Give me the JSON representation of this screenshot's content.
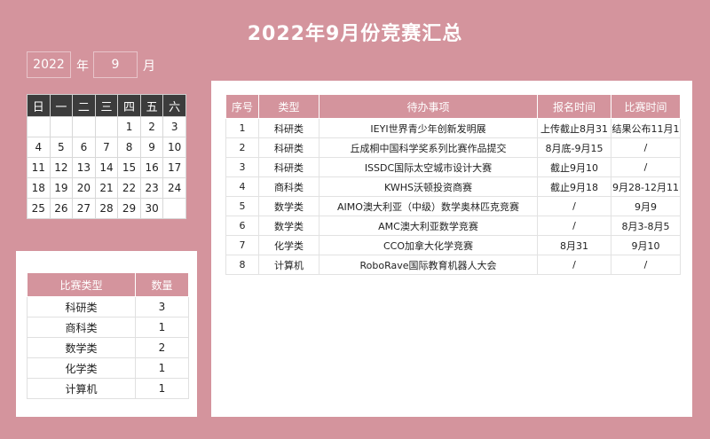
{
  "title": "2022年9月份竞赛汇总",
  "selector": {
    "year": "2022",
    "year_label": "年",
    "month": "9",
    "month_label": "月"
  },
  "calendar": {
    "weekdays": [
      "日",
      "一",
      "二",
      "三",
      "四",
      "五",
      "六"
    ],
    "weeks": [
      [
        "",
        "",
        "",
        "",
        "1",
        "2",
        "3"
      ],
      [
        "4",
        "5",
        "6",
        "7",
        "8",
        "9",
        "10"
      ],
      [
        "11",
        "12",
        "13",
        "14",
        "15",
        "16",
        "17"
      ],
      [
        "18",
        "19",
        "20",
        "21",
        "22",
        "23",
        "24"
      ],
      [
        "25",
        "26",
        "27",
        "28",
        "29",
        "30",
        ""
      ]
    ]
  },
  "events": {
    "headers": [
      "序号",
      "类型",
      "待办事项",
      "报名时间",
      "比赛时间"
    ],
    "rows": [
      [
        "1",
        "科研类",
        "IEYI世界青少年创新发明展",
        "上传截止8月31",
        "结果公布11月1"
      ],
      [
        "2",
        "科研类",
        "丘成桐中国科学奖系列比赛作品提交",
        "8月底-9月15",
        "/"
      ],
      [
        "3",
        "科研类",
        "ISSDC国际太空城市设计大赛",
        "截止9月10",
        "/"
      ],
      [
        "4",
        "商科类",
        "KWHS沃顿投资商赛",
        "截止9月18",
        "9月28-12月11"
      ],
      [
        "5",
        "数学类",
        "AIMO澳大利亚（中级）数学奥林匹克竞赛",
        "/",
        "9月9"
      ],
      [
        "6",
        "数学类",
        "AMC澳大利亚数学竞赛",
        "/",
        "8月3-8月5"
      ],
      [
        "7",
        "化学类",
        "CCO加拿大化学竞赛",
        "8月31",
        "9月10"
      ],
      [
        "8",
        "计算机",
        "RoboRave国际教育机器人大会",
        "/",
        "/"
      ]
    ]
  },
  "summary": {
    "headers": [
      "比赛类型",
      "数量"
    ],
    "rows": [
      [
        "科研类",
        "3"
      ],
      [
        "商科类",
        "1"
      ],
      [
        "数学类",
        "2"
      ],
      [
        "化学类",
        "1"
      ],
      [
        "计算机",
        "1"
      ]
    ]
  }
}
